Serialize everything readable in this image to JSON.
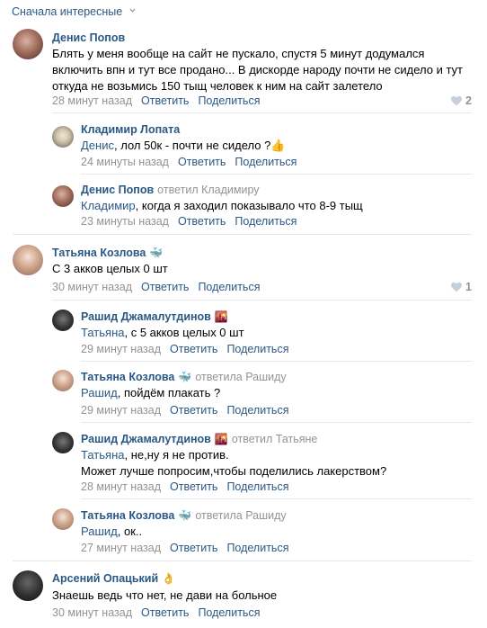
{
  "sort": {
    "label": "Сначала интересные"
  },
  "comments": [
    {
      "name": "Денис Попов",
      "text1": "Блять у меня вообще на сайт не пускало, спустя 5 минут додумался",
      "text2": "включить впн и тут все продано... В дискорде народу почти не сидело и тут",
      "text3": "откуда не возьмись 150 тыщ человек к ним на сайт залетело",
      "time": "28 минут назад",
      "reply": "Ответить",
      "share": "Поделиться",
      "likes": "2"
    },
    {
      "name": "Кладимир Лопата",
      "addr": "Денис",
      "text": ", лол 50к - почти не сидело ?👍",
      "time": "24 минуты назад",
      "reply": "Ответить",
      "share": "Поделиться"
    },
    {
      "name": "Денис Попов",
      "replied": "ответил Кладимиру",
      "addr": "Кладимир",
      "text": ", когда я заходил показывало что 8-9 тыщ",
      "time": "23 минуты назад",
      "reply": "Ответить",
      "share": "Поделиться"
    },
    {
      "name": "Татьяна Козлова",
      "emoji": "🐳",
      "text": "С 3 акков целых 0 шт",
      "time": "30 минут назад",
      "reply": "Ответить",
      "share": "Поделиться",
      "likes": "1"
    },
    {
      "name": "Рашид Джамалутдинов",
      "emoji": "🌇",
      "addr": "Татьяна",
      "text": ", с 5 акков целых 0 шт",
      "time": "29 минут назад",
      "reply": "Ответить",
      "share": "Поделиться"
    },
    {
      "name": "Татьяна Козлова",
      "emoji": "🐳",
      "replied": "ответила Рашиду",
      "addr": "Рашид",
      "text": ", пойдём плакать ?",
      "time": "29 минут назад",
      "reply": "Ответить",
      "share": "Поделиться"
    },
    {
      "name": "Рашид Джамалутдинов",
      "emoji": "🌇",
      "replied": "ответил Татьяне",
      "addr": "Татьяна",
      "text": ", не,ну я не против.",
      "text2": "Может лучше попросим,чтобы поделились лакерством?",
      "time": "28 минут назад",
      "reply": "Ответить",
      "share": "Поделиться"
    },
    {
      "name": "Татьяна Козлова",
      "emoji": "🐳",
      "replied": "ответила Рашиду",
      "addr": "Рашид",
      "text": ", ок..",
      "time": "27 минут назад",
      "reply": "Ответить",
      "share": "Поделиться"
    },
    {
      "name": "Арсений Опацький",
      "emoji": "👌",
      "text": "Знаешь ведь что нет, не дави на больное",
      "time": "30 минут назад",
      "reply": "Ответить",
      "share": "Поделиться"
    }
  ]
}
